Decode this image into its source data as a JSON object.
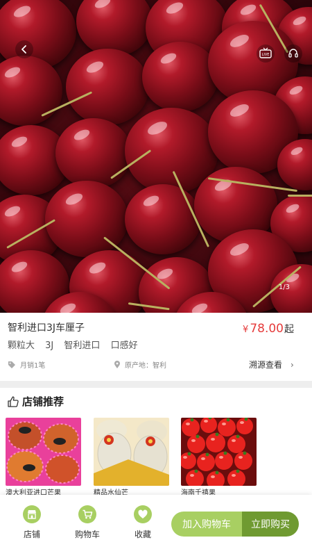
{
  "hero": {
    "image_counter": "1/3",
    "live_badge": "LIVE"
  },
  "product": {
    "title": "智利进口3J车厘子",
    "price_symbol": "¥",
    "price": "78.00",
    "price_suffix": "起",
    "tags": [
      "颗粒大",
      "3J",
      "智利进口",
      "口感好"
    ],
    "sales": "月销1笔",
    "origin": "原产地：智利",
    "trace_label": "溯源查看"
  },
  "shop": {
    "heading": "店铺推荐",
    "items": [
      {
        "name": "澳大利亚进口芒果"
      },
      {
        "name": "精品水仙芒"
      },
      {
        "name": "海南千禧果"
      }
    ]
  },
  "bottom_bar": {
    "tabs": [
      {
        "label": "店铺",
        "icon": "store-icon"
      },
      {
        "label": "购物车",
        "icon": "cart-icon"
      },
      {
        "label": "收藏",
        "icon": "heart-icon"
      }
    ],
    "add_to_cart": "加入购物车",
    "buy_now": "立即购买"
  },
  "colors": {
    "accent": "#a8cf62",
    "accent_dark": "#6f9a31",
    "price": "#e53b3b"
  }
}
